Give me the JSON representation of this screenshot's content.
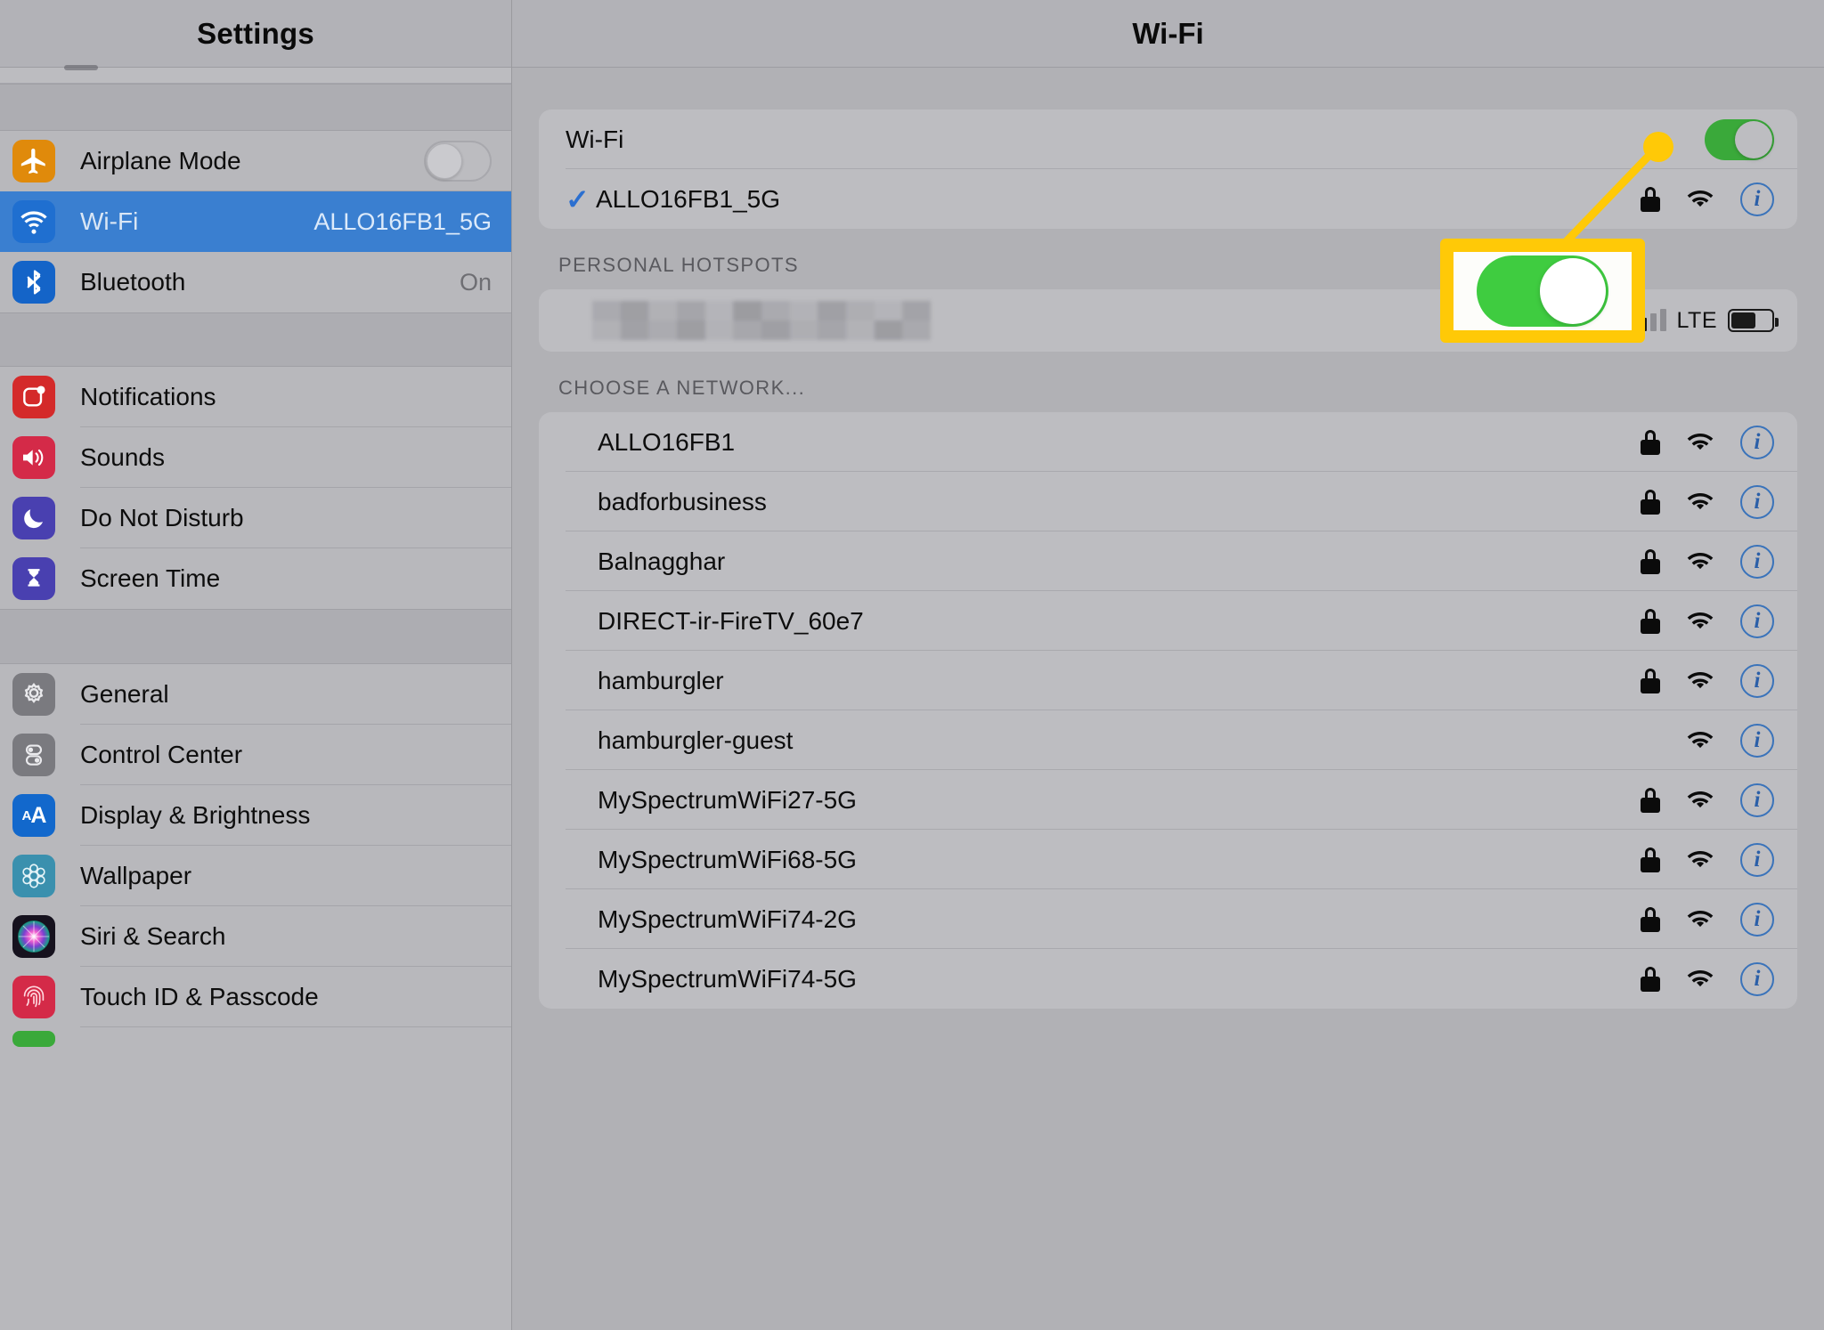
{
  "sidebar": {
    "title": "Settings",
    "groups": [
      {
        "items": [
          {
            "label": "Airplane Mode",
            "icon": "airplane-icon",
            "control": "toggle-off",
            "value": ""
          },
          {
            "label": "Wi-Fi",
            "icon": "wifi-icon",
            "control": "value",
            "value": "ALLO16FB1_5G",
            "selected": true
          },
          {
            "label": "Bluetooth",
            "icon": "bluetooth-icon",
            "control": "value",
            "value": "On"
          }
        ]
      },
      {
        "items": [
          {
            "label": "Notifications",
            "icon": "notifications-icon",
            "control": "none",
            "value": ""
          },
          {
            "label": "Sounds",
            "icon": "sounds-icon",
            "control": "none",
            "value": ""
          },
          {
            "label": "Do Not Disturb",
            "icon": "moon-icon",
            "control": "none",
            "value": ""
          },
          {
            "label": "Screen Time",
            "icon": "hourglass-icon",
            "control": "none",
            "value": ""
          }
        ]
      },
      {
        "items": [
          {
            "label": "General",
            "icon": "gear-icon",
            "control": "none",
            "value": ""
          },
          {
            "label": "Control Center",
            "icon": "control-center-icon",
            "control": "none",
            "value": ""
          },
          {
            "label": "Display & Brightness",
            "icon": "display-brightness-icon",
            "control": "none",
            "value": ""
          },
          {
            "label": "Wallpaper",
            "icon": "wallpaper-icon",
            "control": "none",
            "value": ""
          },
          {
            "label": "Siri & Search",
            "icon": "siri-icon",
            "control": "none",
            "value": ""
          },
          {
            "label": "Touch ID & Passcode",
            "icon": "fingerprint-icon",
            "control": "none",
            "value": ""
          }
        ]
      }
    ]
  },
  "main": {
    "title": "Wi-Fi",
    "wifi_row": {
      "label": "Wi-Fi",
      "toggle_state": "on"
    },
    "connected_network": {
      "name": "ALLO16FB1_5G",
      "checked": true
    },
    "hotspots_header": "PERSONAL HOTSPOTS",
    "hotspot_row": {
      "name_blurred": true,
      "signal_label": "LTE",
      "signal_bars_filled": 2,
      "signal_bars_total": 4,
      "battery_level_pct": 62
    },
    "networks_header": "CHOOSE A NETWORK...",
    "networks": [
      {
        "name": "ALLO16FB1",
        "locked": true,
        "wifi": true,
        "info": true
      },
      {
        "name": "badforbusiness",
        "locked": true,
        "wifi": true,
        "info": true
      },
      {
        "name": "Balnagghar",
        "locked": true,
        "wifi": true,
        "info": true
      },
      {
        "name": "DIRECT-ir-FireTV_60e7",
        "locked": true,
        "wifi": true,
        "info": true
      },
      {
        "name": "hamburgler",
        "locked": true,
        "wifi": true,
        "info": true
      },
      {
        "name": "hamburgler-guest",
        "locked": false,
        "wifi": true,
        "info": true
      },
      {
        "name": "MySpectrumWiFi27-5G",
        "locked": true,
        "wifi": true,
        "info": true
      },
      {
        "name": "MySpectrumWiFi68-5G",
        "locked": true,
        "wifi": true,
        "info": true
      },
      {
        "name": "MySpectrumWiFi74-2G",
        "locked": true,
        "wifi": true,
        "info": true
      },
      {
        "name": "MySpectrumWiFi74-5G",
        "locked": true,
        "wifi": true,
        "info": true
      }
    ]
  },
  "annotation": {
    "type": "callout-magnifier",
    "target": "wifi-master-toggle",
    "border_color": "#ffc907",
    "toggle_state": "on",
    "toggle_color": "#3fcc40"
  },
  "colors": {
    "selection_blue": "#3a7fd0",
    "toggle_green": "#3aa93a",
    "highlight_yellow": "#ffc907",
    "info_blue": "#3a73ba",
    "panel_bg": "#b1b1b5",
    "card_bg": "#bdbdc1"
  }
}
